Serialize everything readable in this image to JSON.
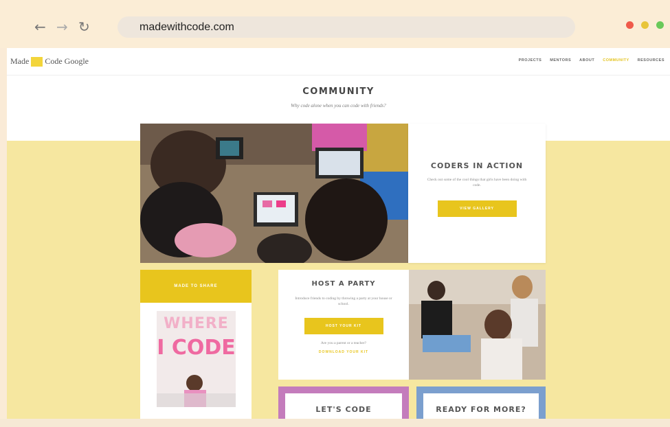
{
  "browser": {
    "back_icon": "arrow-left-icon",
    "forward_icon": "arrow-right-icon",
    "reload_icon": "reload-icon",
    "url": "madewithcode.com",
    "window_controls": {
      "red": "#ef5a4a",
      "yellow": "#e8c53a",
      "green": "#69c95a"
    }
  },
  "site": {
    "logo": {
      "part1": "Made",
      "part2": "Code",
      "part3": "Google"
    },
    "nav": [
      {
        "label": "PROJECTS"
      },
      {
        "label": "MENTORS"
      },
      {
        "label": "ABOUT"
      },
      {
        "label": "COMMUNITY",
        "active": true
      },
      {
        "label": "RESOURCES"
      }
    ],
    "accent": "#e8c51d"
  },
  "section": {
    "title": "COMMUNITY",
    "subtitle": "Why code alone when you can code with friends?"
  },
  "hero": {
    "title": "CODERS IN ACTION",
    "text": "Check out some of the cool things that girls have been doing with code.",
    "button": "VIEW GALLERY"
  },
  "made_card": {
    "header": "MADE TO SHARE",
    "poster_line1": "WHERE",
    "poster_line2": "I CODE"
  },
  "party_card": {
    "title": "HOST A PARTY",
    "text": "Introduce friends to coding by throwing a party at your house or school.",
    "button": "HOST YOUR KIT",
    "question": "Are you a parent or a teacher?",
    "link": "DOWNLOAD YOUR KIT"
  },
  "code_card": {
    "title": "LET'S CODE",
    "color": "#c47cbc"
  },
  "more_card": {
    "title": "READY FOR MORE?",
    "color": "#7b9fce"
  }
}
